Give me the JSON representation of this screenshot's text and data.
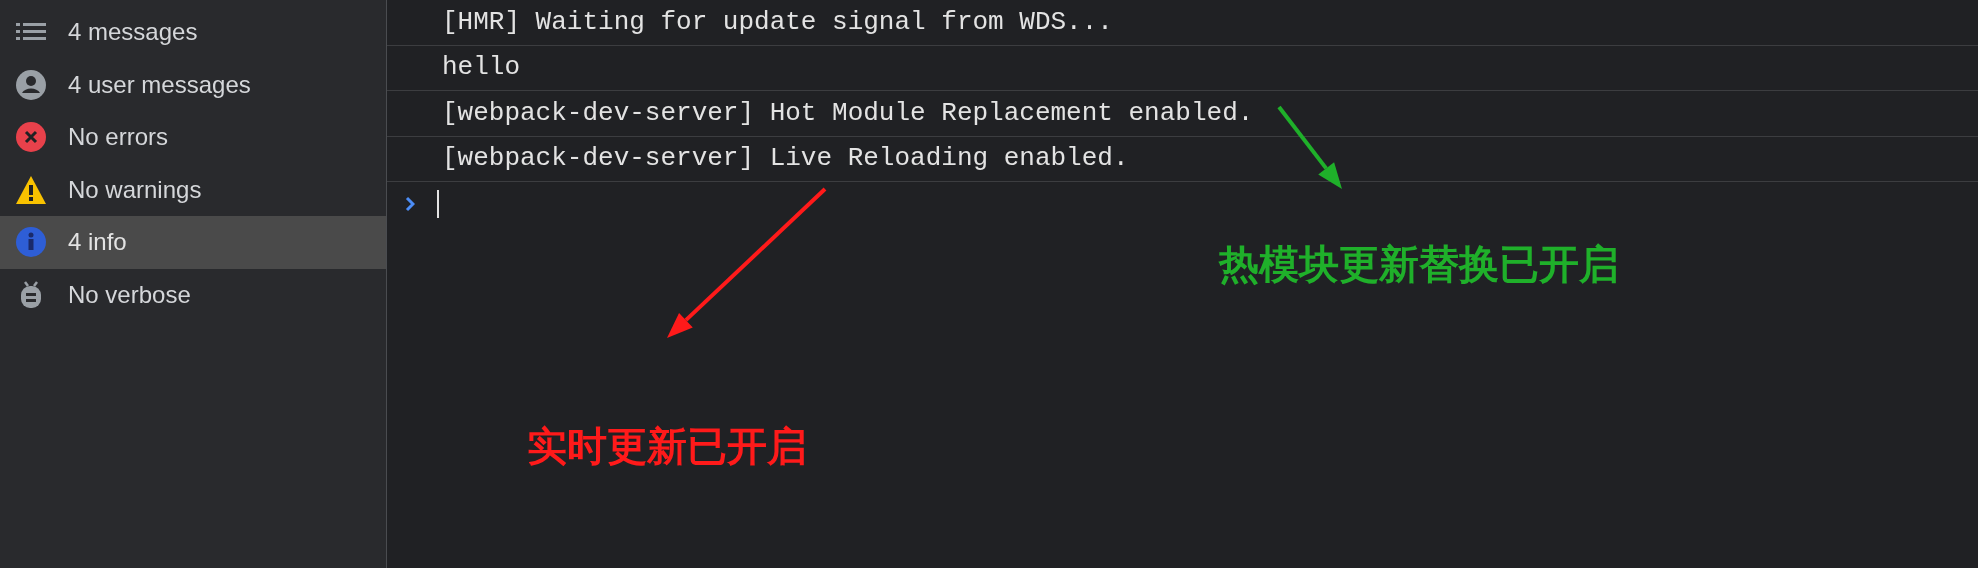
{
  "sidebar": {
    "items": [
      {
        "kind": "messages",
        "label": "4 messages",
        "selected": false
      },
      {
        "kind": "user",
        "label": "4 user messages",
        "selected": false
      },
      {
        "kind": "error",
        "label": "No errors",
        "selected": false
      },
      {
        "kind": "warning",
        "label": "No warnings",
        "selected": false
      },
      {
        "kind": "info",
        "label": "4 info",
        "selected": true
      },
      {
        "kind": "verbose",
        "label": "No verbose",
        "selected": false
      }
    ]
  },
  "console": {
    "lines": [
      "[HMR] Waiting for update signal from WDS...",
      "hello",
      "[webpack-dev-server] Hot Module Replacement enabled.",
      "[webpack-dev-server] Live Reloading enabled."
    ]
  },
  "annotations": [
    {
      "text": "实时更新已开启",
      "color": "#ff1a1a"
    },
    {
      "text": "热模块更新替换已开启",
      "color": "#1fb02a"
    }
  ]
}
